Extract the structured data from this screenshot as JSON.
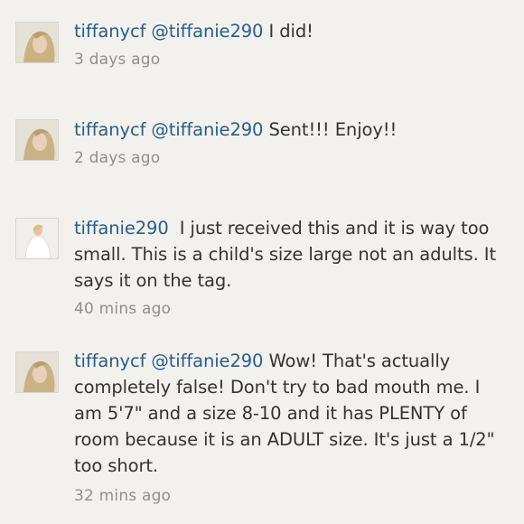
{
  "comments": [
    {
      "username": "tiffanycf",
      "mention": "@tiffanie290",
      "text": "I did!",
      "time": "3 days ago"
    },
    {
      "username": "tiffanycf",
      "mention": "@tiffanie290",
      "text": "Sent!!! Enjoy!!",
      "time": "2 days ago"
    },
    {
      "username": "tiffanie290",
      "mention": "",
      "text": "I just received this and it is way too small. This is a child's size large not an adults. It says it on the tag.",
      "time": "40 mins ago"
    },
    {
      "username": "tiffanycf",
      "mention": "@tiffanie290",
      "text": "Wow! That's actually completely false! Don't try to bad mouth me. I am 5'7\" and a size 8-10 and it has PLENTY of room because it is an ADULT size. It's just a 1/2\" too short.",
      "time": "32 mins ago"
    }
  ],
  "colors": {
    "background": "#f2f1ee",
    "username": "#2c5d84",
    "text": "#333333",
    "timestamp": "#8f8f8f"
  }
}
